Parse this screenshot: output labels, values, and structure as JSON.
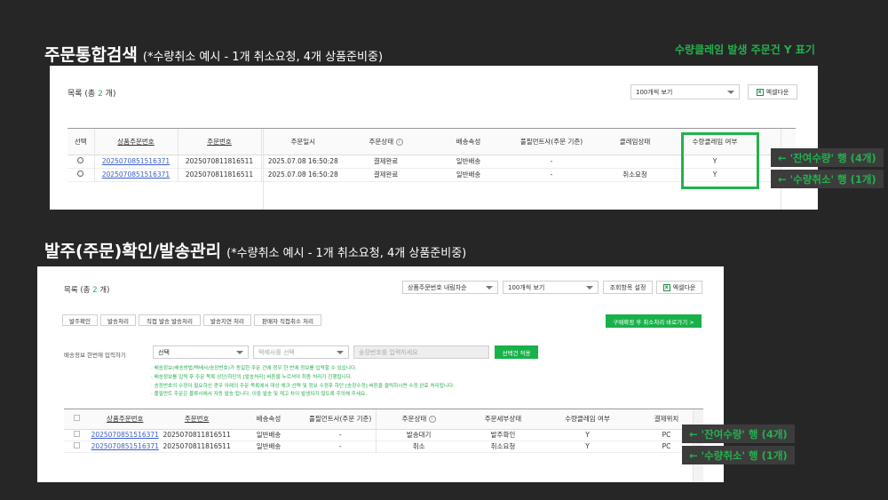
{
  "section1": {
    "title": "주문통합검색",
    "subtitle": "(*수량취소 예시 - 1개 취소요청, 4개 상품준비중)",
    "note": "수량클레임 발생 주문건 Y 표기",
    "list_title_prefix": "목록 (총 ",
    "list_count": "2",
    "list_title_suffix": " 개)",
    "page_size": "100개씩 보기",
    "excel_button": "엑셀다운",
    "columns": [
      "선택",
      "상품주문번호",
      "주문번호",
      "주문일시",
      "주문상태",
      "배송속성",
      "풀필먼트사(주문 기준)",
      "클레임상태",
      "수량클레임 여부"
    ],
    "rows": [
      {
        "product_order_no": "2025070851516371",
        "order_no": "2025070811816511",
        "order_datetime": "2025.07.08 16:50:28",
        "status": "결제완료",
        "delivery": "일반배송",
        "fulfillment": "-",
        "claim_status": "",
        "qty_claim": "Y"
      },
      {
        "product_order_no": "2025070851516371",
        "order_no": "2025070811816511",
        "order_datetime": "2025.07.08 16:50:28",
        "status": "결제완료",
        "delivery": "일반배송",
        "fulfillment": "-",
        "claim_status": "취소요청",
        "qty_claim": "Y"
      }
    ],
    "labels": [
      "← '잔여수량' 행 (4개)",
      "← '수량취소' 행 (1개)"
    ]
  },
  "section2": {
    "title": "발주(주문)확인/발송관리",
    "subtitle": "(*수량취소 예시 - 1개 취소요청, 4개 상품준비중)",
    "list_title_prefix": "목록 (총 ",
    "list_count": "2",
    "list_title_suffix": " 개)",
    "sort_select": "상품주문번호 내림차순",
    "page_size": "100개씩 보기",
    "settings_button": "조회항목 설정",
    "excel_button": "엑셀다운",
    "tabs": [
      "발주확인",
      "발송처리",
      "직접 발송 발송처리",
      "발송지연 처리",
      "판매자 직접취소 처리"
    ],
    "green_button": "구매확정 후 취소처리 바로가기 >",
    "bulk_label": "배송정보 한번에 입력하기",
    "bulk_select": "선택",
    "courier_placeholder": "택배사를 선택",
    "tracking_placeholder": "송장번호를 입력하세요",
    "apply_button": "선택건 적용",
    "notices": [
      "배송정보(배송방법/택배사/송장번호)가 동일한 주문 건에 경우 한 번에 정보를 입력할 수 있습니다.",
      "배송정보를 입력 후 주문 목록 상단/하단의 [발송처리] 버튼을 누르셔야 최종 처리가 진행됩니다.",
      "송장번호의 수정이 필요하신 경우 아래의 주문 목록에서 대상 체크 선택 및 정보 수정후 하단 [송장수정] 버튼을 클릭하시면 수정 완료 처리됩니다.",
      "풀필먼트 주문은 물류사에서 자동 발송 됩니다. 이중 발송 및 재고 차이 발생되지 않도록 주의해 주세요."
    ],
    "columns": [
      "상품주문번호",
      "주문번호",
      "배송속성",
      "풀필먼트사(주문 기준)",
      "주문상태",
      "주문세부상태",
      "수량클레임 여부",
      "결제위치"
    ],
    "rows": [
      {
        "product_order_no": "2025070851516371",
        "order_no": "2025070811816511",
        "delivery": "일반배송",
        "fulfillment": "-",
        "status": "발송대기",
        "detail": "발주확인",
        "qty_claim": "Y",
        "pay": "PC"
      },
      {
        "product_order_no": "2025070851516371",
        "order_no": "2025070811816511",
        "delivery": "일반배송",
        "fulfillment": "-",
        "status": "취소",
        "detail": "취소요청",
        "qty_claim": "Y",
        "pay": "PC"
      }
    ],
    "labels": [
      "← '잔여수량' 행 (4개)",
      "← '수량취소' 행 (1개)"
    ]
  },
  "colors": {
    "accent_green": "#23b14d",
    "link_blue": "#3b5ec6",
    "background": "#262626"
  }
}
